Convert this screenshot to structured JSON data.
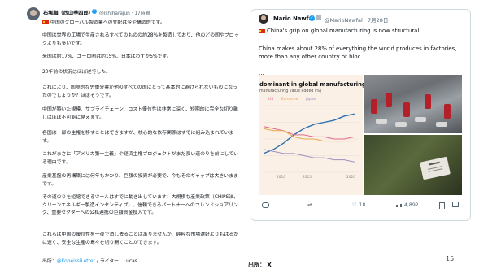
{
  "left_post": {
    "author": "石塚順（西山季四郎）",
    "handle_time": "@ishiharajun · 17時間",
    "paragraphs": [
      "中国のグローバル製造業への支配は今や構造的です。",
      "中国は世界の工場で生産されるすべてのものの約28%を製造しており、他のどの国やブロックよりも多いです。",
      "米国は約17%、ユーロ圏は約15%、日本はわずか5%です。",
      "20年前の状況はほぼ逆でした。",
      "これにより、国際的な労働分業が他のすべての国にとって基本的に避けられないものになったのでしょうか？ほぼそうです。",
      "中国が築いた規模、サプライチェーン、コスト優位性は非常に深く、短期的に完全な切り離しはほぼ不可能に見えます。",
      "各国は一部の主権を移すことはできますが、核心的な依存関係はすでに組み込まれています。",
      "これがまさに「アメリカ第一主義」や経済主権プロジェクトがまだ長い道のりを前にしている理由です。",
      "産業基盤の再構築には何年もかかり、巨額の投資が必要で、今もそのギャップは大きいままです。",
      "その道のりを短縮できるツールはすでに動き出しています：大規模な産業政策（CHIPS法、クリーンエネルギー製造インセンティブ）、信頼できるパートナーへのフレンドショアリング、重要セクターへの公私連携の巨額資金投入です。",
      "これらは中国の優位性を一夜で消し去ることはありませんが、純粋な市場選好よりもはるかに速く、安全な生産の島々を切り開くことができます。"
    ],
    "source_prefix": "出所：",
    "source_link": "@KobeissiLetter",
    "source_suffix": " / ライター：Lucas"
  },
  "right_card": {
    "author": "Mario Nawfal",
    "handle_time": "@MarioNawfal · 7月28日",
    "headline": "China's grip on global manufacturing is now structural.",
    "body": "China makes about 28% of everything the world produces in factories, more than any other country or bloc.",
    "ellipsis": "...",
    "chart": {
      "title": "dominant in global manufacturing",
      "subtitle": "manufacturing value added (%)",
      "legend": [
        "US",
        "Eurozone",
        "Japan"
      ],
      "ticks": [
        "2010",
        "2015",
        "2020"
      ]
    },
    "actions": {
      "replies": "",
      "retweets": "",
      "likes": "18",
      "views": "4,892"
    }
  },
  "footer": {
    "citation": "出所： X",
    "page_number": "15"
  },
  "colors": {
    "accent_blue": "#1d9bf0",
    "china_line": "#2a6fb0",
    "us_line": "#e06b8a",
    "eurozone_line": "#e8a94a",
    "japan_line": "#9e8fc0"
  },
  "chart_data": {
    "type": "line",
    "title": "dominant in global manufacturing",
    "subtitle": "manufacturing value added (%)",
    "x": [
      2004,
      2006,
      2008,
      2010,
      2012,
      2014,
      2016,
      2018,
      2020,
      2022
    ],
    "xlim": [
      2004,
      2023
    ],
    "ylim": [
      0,
      32
    ],
    "series": [
      {
        "values": [
          9,
          11,
          14,
          18,
          21,
          23,
          24,
          25,
          27,
          28
        ]
      },
      {
        "name": "US",
        "values": [
          22,
          21,
          20,
          18,
          18,
          17,
          17,
          16,
          16,
          17
        ]
      },
      {
        "name": "Eurozone",
        "values": [
          21,
          20,
          20,
          17,
          16,
          16,
          15,
          15,
          15,
          15
        ]
      },
      {
        "name": "Japan",
        "values": [
          11,
          10,
          9,
          9,
          8,
          7,
          7,
          6,
          6,
          5
        ]
      }
    ]
  }
}
